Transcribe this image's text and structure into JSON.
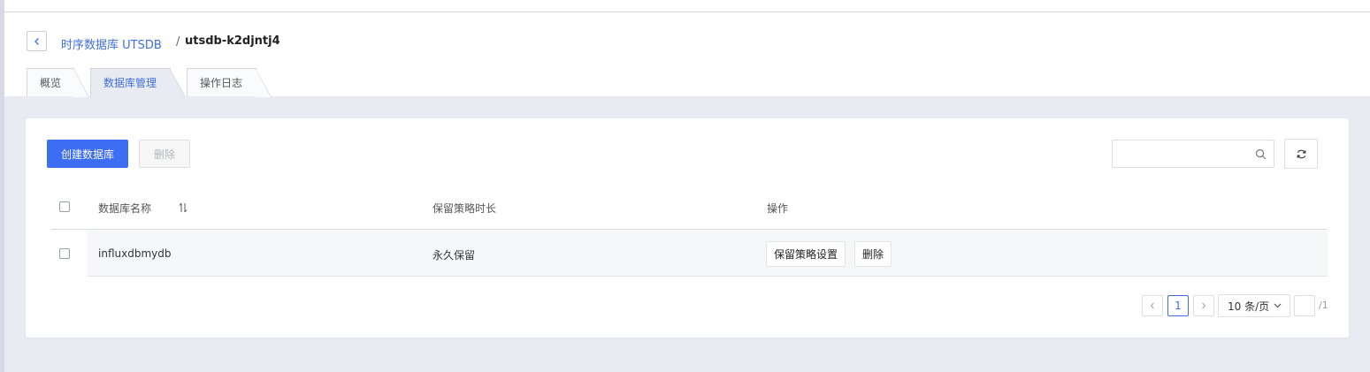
{
  "breadcrumb": {
    "parent": "时序数据库 UTSDB",
    "separator": "/",
    "current": "utsdb-k2djntj4"
  },
  "tabs": [
    {
      "label": "概览"
    },
    {
      "label": "数据库管理",
      "active": true
    },
    {
      "label": "操作日志"
    }
  ],
  "toolbar": {
    "create_label": "创建数据库",
    "delete_label": "删除",
    "search_placeholder": ""
  },
  "table": {
    "columns": [
      "数据库名称",
      "保留策略时长",
      "操作"
    ],
    "rows": [
      {
        "name": "influxdbmydb",
        "retention": "永久保留",
        "actions": [
          "保留策略设置",
          "删除"
        ]
      }
    ]
  },
  "pagination": {
    "current_page": "1",
    "page_size": "10 条/页",
    "total": "/1"
  },
  "colors": {
    "accent": "#3d6df2",
    "link": "#3f6ee0",
    "background": "#e9ebf3"
  },
  "icons": [
    "back-icon",
    "search-icon",
    "refresh-icon",
    "sort-icon",
    "chevron-left-icon",
    "chevron-right-icon",
    "chevron-down-icon"
  ]
}
